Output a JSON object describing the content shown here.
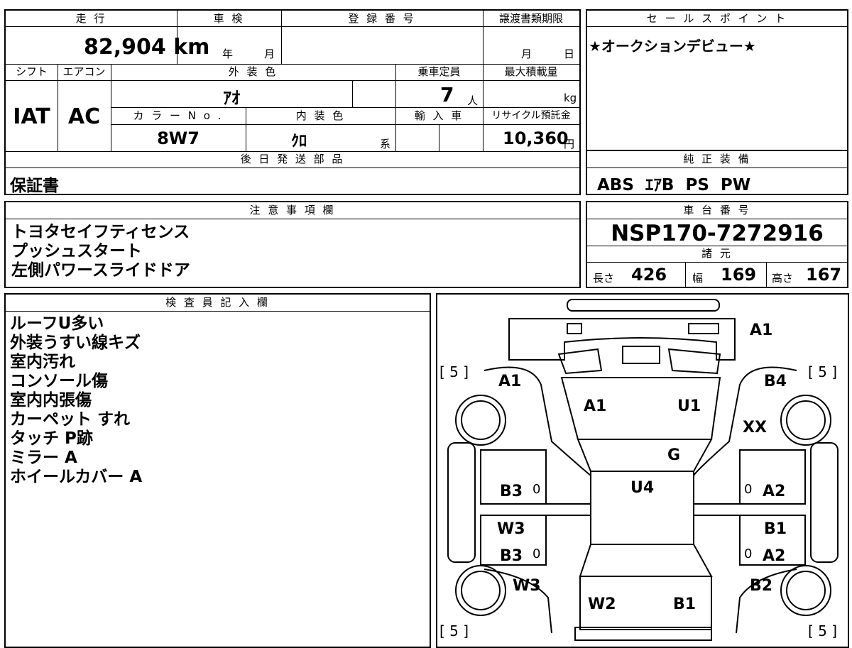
{
  "headers": {
    "mileage": "走 行",
    "shaken": "車 検",
    "registration": "登 録 番 号",
    "transfer_deadline": "譲渡書類期限",
    "sales_point": "セ ー ル ス ポ イ ン ト",
    "shift": "シフト",
    "aircon": "エアコン",
    "exterior_color": "外 装 色",
    "capacity": "乗車定員",
    "max_load": "最大積載量",
    "color_no": "カ ラ ー N o .",
    "interior_color": "内 装 色",
    "import": "輸 入 車",
    "recycle_fee": "リサイクル預託金",
    "later_items": "後 日 発 送 部 品",
    "genuine_equipment": "純 正 装 備",
    "notes": "注 意 事 項 欄",
    "chassis_number": "車 台 番 号",
    "specs": "諸 元",
    "inspector": "検 査 員 記 入 欄"
  },
  "values": {
    "mileage": "82,904 km",
    "shaken_year": "年",
    "shaken_month": "月",
    "deadline_month": "月",
    "deadline_day": "日",
    "sales_point": "★オークションデビュー★",
    "shift": "IAT",
    "aircon": "AC",
    "exterior_color": "ｱｵ",
    "capacity": "7",
    "capacity_unit": "人",
    "max_load_unit": "kg",
    "color_no": "8W7",
    "interior_color": "ｸﾛ",
    "interior_suffix": "系",
    "recycle_fee": "10,360",
    "recycle_unit": "円",
    "later_items": "保証書",
    "genuine_equipment": "ABS  ｴｱB  PS  PW",
    "chassis_number": "NSP170-7272916",
    "length_label": "長さ",
    "length": "426",
    "width_label": "幅",
    "width": "169",
    "height_label": "高さ",
    "height": "167"
  },
  "notes": [
    "トヨタセイフティセンス",
    "プッシュスタート",
    "左側パワースライドドア"
  ],
  "inspector_notes": [
    "ルーフU多い",
    "外装うすい線キズ",
    "室内汚れ",
    "コンソール傷",
    "室内内張傷",
    "カーペット すれ",
    "タッチ P跡",
    "ミラー A",
    "ホイールカバー A"
  ],
  "diagram": {
    "tire_marks": [
      "[ 5 ]",
      "[ 5 ]",
      "[ 5 ]",
      "[ 5 ]"
    ],
    "codes": {
      "front_bumper": "A1",
      "left_front_fender": "A1",
      "right_front_fender": "B4",
      "right_front_corner": "XX",
      "hood_left": "A1",
      "hood_right": "U1",
      "windshield": "G",
      "roof": "U4",
      "left_front_door": "B3",
      "left_front_door_mark": "0",
      "right_front_door": "A2",
      "right_front_door_mark": "0",
      "left_mid": "W3",
      "right_mid": "B1",
      "left_rear_door": "B3",
      "left_rear_door_mark": "0",
      "right_rear_door": "A2",
      "right_rear_door_mark": "0",
      "left_rear_fender": "W3",
      "right_rear_fender": "B2",
      "rear_left": "W2",
      "rear_right": "B1"
    }
  }
}
